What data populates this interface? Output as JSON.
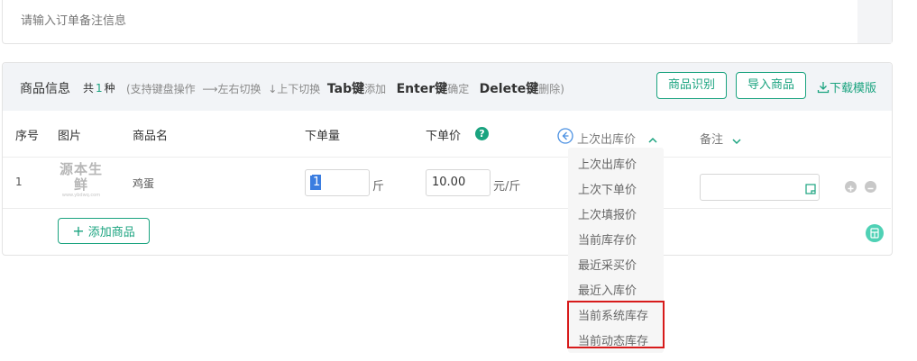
{
  "remark": {
    "placeholder": "请输入订单备注信息"
  },
  "goods": {
    "title": "商品信息",
    "count_prefix": "共",
    "count": "1",
    "count_suffix": "种",
    "hint_open": "(支持键盘操作",
    "hint_lr": "⟶左右切换",
    "hint_ud": "↓上下切换",
    "key_tab": "Tab键",
    "act_add": "添加",
    "key_enter": "Enter键",
    "act_confirm": "确定",
    "key_delete": "Delete键",
    "act_delete": "删除)",
    "btn_recognize": "商品识别",
    "btn_import": "导入商品",
    "link_template": "下载模版"
  },
  "table": {
    "headers": {
      "index": "序号",
      "image": "图片",
      "name": "商品名",
      "qty": "下单量",
      "price": "下单价",
      "last_out": "上次出库价",
      "remark": "备注"
    },
    "rows": [
      {
        "index": "1",
        "image_text": "源本生鲜",
        "image_sub": "www.ybdwq.com",
        "name": "鸡蛋",
        "qty": "1",
        "qty_unit": "斤",
        "price": "10.00",
        "price_unit": "元/斤",
        "remark": ""
      }
    ],
    "add_button": "添加商品"
  },
  "dropdown": {
    "items": [
      "上次出库价",
      "上次下单价",
      "上次填报价",
      "当前库存价",
      "最近采买价",
      "最近入库价",
      "当前系统库存",
      "当前动态库存"
    ],
    "highlighted": [
      "当前系统库存",
      "当前动态库存"
    ]
  },
  "colors": {
    "accent": "#1aa37f",
    "highlight": "#d71b1b",
    "info": "#4a90e2"
  }
}
